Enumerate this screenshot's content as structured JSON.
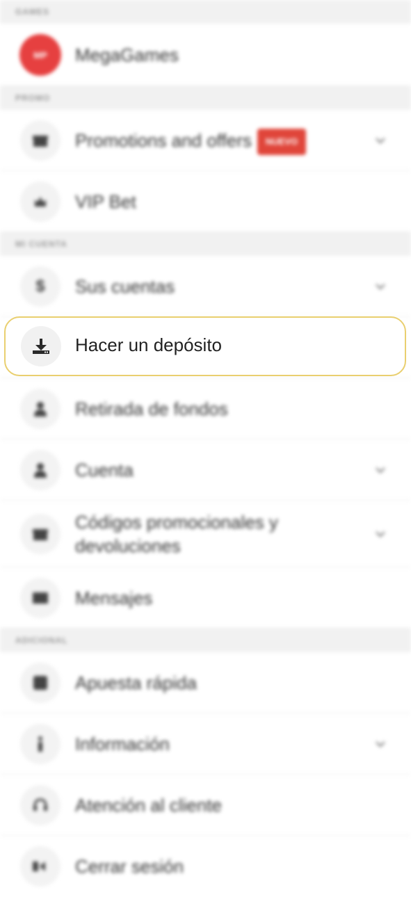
{
  "sections": [
    {
      "id": "games",
      "title": "GAMES"
    },
    {
      "id": "promo",
      "title": "PROMO"
    },
    {
      "id": "account",
      "title": "MI CUENTA"
    },
    {
      "id": "additional",
      "title": "ADICIONAL"
    }
  ],
  "items": {
    "megagames": {
      "label": "MegaGames",
      "logo_text": "MP",
      "icon": "megagames-logo"
    },
    "promotions": {
      "label": "Promotions and offers",
      "badge": "NUEVO",
      "icon": "gift-icon"
    },
    "vip_bet": {
      "label": "VIP Bet",
      "icon": "crown-icon"
    },
    "accounts": {
      "label": "Sus cuentas",
      "icon": "dollar-icon"
    },
    "deposit": {
      "label": "Hacer un depósito",
      "icon": "download-tray-icon"
    },
    "withdraw": {
      "label": "Retirada de fondos",
      "icon": "person-icon"
    },
    "profile": {
      "label": "Cuenta",
      "icon": "person-icon"
    },
    "promo_codes": {
      "label": "Códigos promocionales y devoluciones",
      "icon": "gift-icon"
    },
    "messages": {
      "label": "Mensajes",
      "icon": "envelope-icon"
    },
    "quick_bet": {
      "label": "Apuesta rápida",
      "icon": "quick-bet-icon"
    },
    "info": {
      "label": "Información",
      "icon": "info-icon"
    },
    "support": {
      "label": "Atención al cliente",
      "icon": "headset-icon"
    },
    "logout": {
      "label": "Cerrar sesión",
      "icon": "logout-icon"
    }
  },
  "colors": {
    "accent_red": "#e64040",
    "focus_border": "#e9cf6f",
    "section_bg": "#f1f1f1"
  }
}
